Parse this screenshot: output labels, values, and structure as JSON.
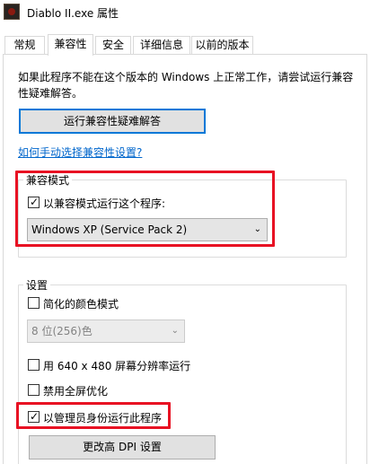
{
  "window": {
    "title": "Diablo II.exe 属性"
  },
  "tabs": [
    {
      "label": "常规"
    },
    {
      "label": "兼容性"
    },
    {
      "label": "安全"
    },
    {
      "label": "详细信息"
    },
    {
      "label": "以前的版本"
    }
  ],
  "compat": {
    "intro": "如果此程序不能在这个版本的 Windows 上正常工作，请尝试运行兼容性疑难解答。",
    "troubleshoot_button": "运行兼容性疑难解答",
    "manual_link": "如何手动选择兼容性设置?",
    "mode_group_label": "兼容模式",
    "mode_checkbox_label": "以兼容模式运行这个程序:",
    "mode_checked": true,
    "mode_select_value": "Windows XP (Service Pack 2)",
    "settings_group_label": "设置",
    "reduced_color_label": "简化的颜色模式",
    "reduced_color_checked": false,
    "color_select_value": "8 位(256)色",
    "res640_label": "用 640 x 480 屏幕分辨率运行",
    "res640_checked": false,
    "disable_fullscreen_label": "禁用全屏优化",
    "disable_fullscreen_checked": false,
    "run_as_admin_label": "以管理员身份运行此程序",
    "run_as_admin_checked": true,
    "dpi_button": "更改高 DPI 设置",
    "check_glyph": "✓",
    "chevron_glyph": "⌄"
  },
  "colors": {
    "highlight": "#e81123",
    "link": "#0066cc",
    "focus_border": "#0078d7"
  }
}
